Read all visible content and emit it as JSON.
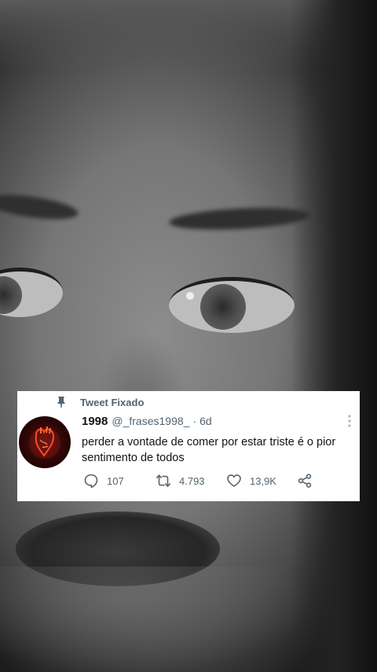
{
  "tweet": {
    "pinned_label": "Tweet Fixado",
    "display_name": "1998",
    "handle": "@_frases1998_",
    "separator": "·",
    "time": "6d",
    "text": "perder a vontade de comer por estar triste é o pior sentimento de todos",
    "stats": {
      "replies": "107",
      "retweets": "4.793",
      "likes": "13,9K"
    }
  },
  "icons": {
    "pin": "pin-icon",
    "more": "more-icon",
    "reply": "reply-icon",
    "retweet": "retweet-icon",
    "like": "heart-icon",
    "share": "share-icon",
    "avatar": "anatomical-heart-avatar"
  },
  "colors": {
    "card_bg": "#ffffff",
    "primary_text": "#0f1419",
    "secondary_text": "#536471",
    "avatar_accent": "#ff4a2a"
  }
}
